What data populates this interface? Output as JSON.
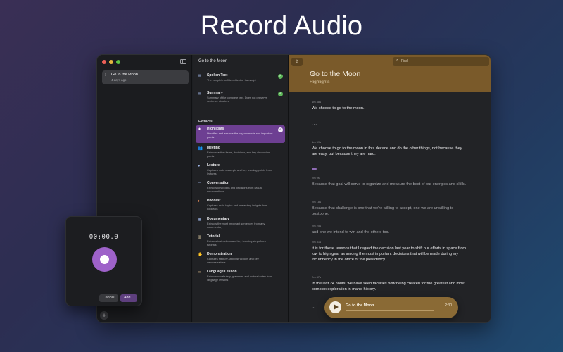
{
  "hero": {
    "title": "Record Audio"
  },
  "sidebar": {
    "recordings": [
      {
        "title": "Go to the Moon",
        "subtitle": "4 days ago"
      }
    ],
    "add_label": "+"
  },
  "middle": {
    "title": "Go to the Moon",
    "top_options": [
      {
        "icon": "spoken-text-icon",
        "name": "Spoken Text",
        "desc": "The complete unfiltered text or transcript",
        "checked": true
      },
      {
        "icon": "summary-icon",
        "name": "Summary",
        "desc": "Summary of the complete text. Does not preserve sentence structure",
        "checked": true
      }
    ],
    "extracts_label": "Extracts",
    "extracts": [
      {
        "icon": "star-icon",
        "name": "Highlights",
        "desc": "Identifies and extracts the key moments and important points",
        "selected": true,
        "checked": true
      },
      {
        "icon": "people-icon",
        "name": "Meeting",
        "desc": "Extracts action items, decisions, and key discussion points"
      },
      {
        "icon": "person-icon",
        "name": "Lecture",
        "desc": "Captures main concepts and key learning points from lectures"
      },
      {
        "icon": "chat-bubbles-icon",
        "name": "Conversation",
        "desc": "Extracts key points and decisions from casual conversations"
      },
      {
        "icon": "microphone-icon",
        "name": "Podcast",
        "desc": "Captures main topics and interesting insights from podcasts"
      },
      {
        "icon": "document-icon",
        "name": "Documentary",
        "desc": "Extracts the most important sentences from any documentary"
      },
      {
        "icon": "book-icon",
        "name": "Tutorial",
        "desc": "Extracts instructions and key learning steps from tutorials"
      },
      {
        "icon": "hand-icon",
        "name": "Demonstration",
        "desc": "Captures step-by-step instructions and key demonstrations"
      },
      {
        "icon": "speech-bubble-icon",
        "name": "Language Lesson",
        "desc": "Extracts vocabulary, grammar, and cultural notes from language lessons"
      }
    ]
  },
  "main": {
    "find_placeholder": "Find",
    "title": "Go to the Moon",
    "subtitle": "Highlights",
    "segments": [
      {
        "ts": "1m 48s",
        "text": "We choose to go to the moon.",
        "dim": false
      },
      {
        "ts": "",
        "text": "...",
        "dim": true,
        "pause": true
      },
      {
        "ts": "1m 59s",
        "text": "We choose to go to the moon in this decade and do the other things, not because they are easy, but because they are hard.",
        "dim": false
      },
      {
        "ts": "2m 9s",
        "text": "Because that goal will serve to organize and measure the best of our energies and skills.",
        "dim": true
      },
      {
        "ts": "2m 18s",
        "text": "Because that challenge is one that we're willing to accept, one we are unwilling to postpone.",
        "dim": true
      },
      {
        "ts": "2m 25s",
        "text": "and one we intend to win and the others too.",
        "dim": true
      },
      {
        "ts": "2m 31s",
        "text": "It is for these reasons that I regard the decision last year to shift our efforts in space from low to high gear as among the most important decisions that will be made during my incumbency in the office of the presidency.",
        "dim": false
      },
      {
        "ts": "2m 47s",
        "text": "In the last 24 hours, we have seen facilities now being created for the greatest and most complex exploration in man's history.",
        "dim": false
      }
    ],
    "ellipsis": "...",
    "player": {
      "title": "Go to the Moon",
      "time": "2:30",
      "progress": 0.0
    }
  },
  "recorder": {
    "timer": "00:00.0",
    "cancel_label": "Cancel",
    "add_label": "Add..."
  }
}
